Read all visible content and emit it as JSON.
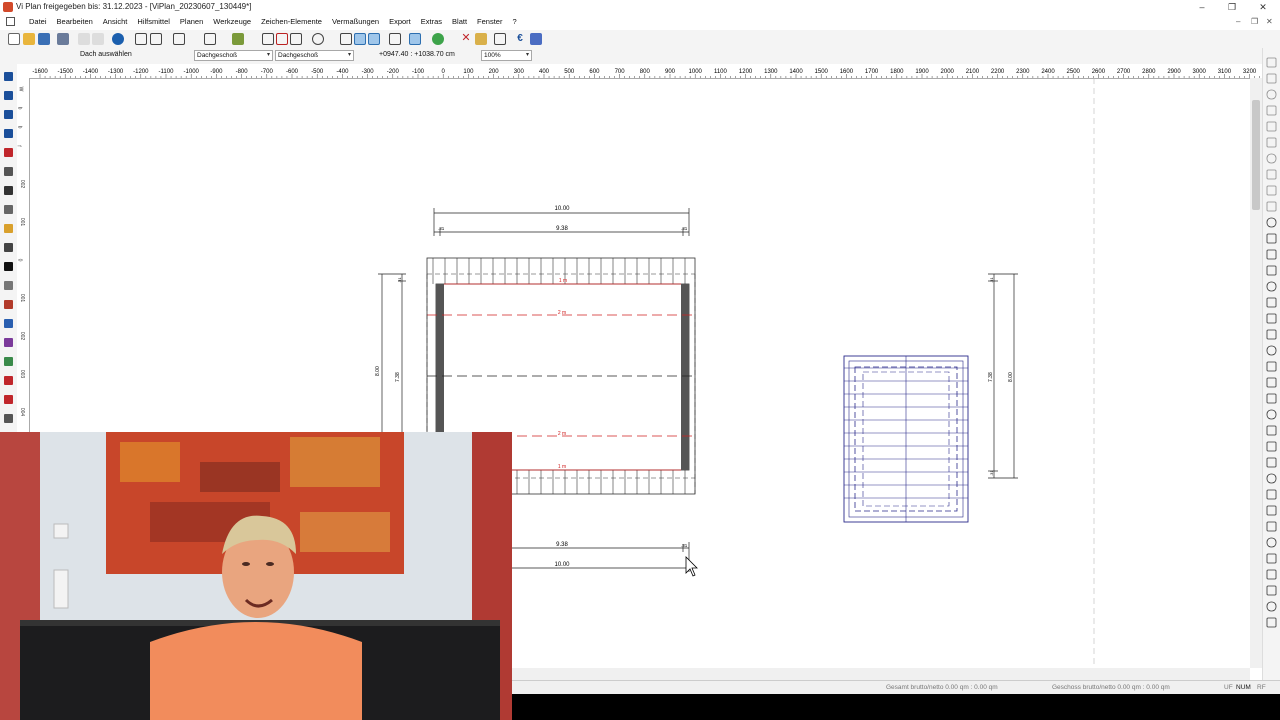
{
  "window": {
    "title": "Vi Plan freigegeben bis: 31.12.2023 - [ViPlan_20230607_130449*]",
    "controls": {
      "minimize": "–",
      "maximize": "❐",
      "close": "✕"
    }
  },
  "menu": {
    "items": [
      "Datei",
      "Bearbeiten",
      "Ansicht",
      "Hilfsmittel",
      "Planen",
      "Werkzeuge",
      "Zeichen-Elemente",
      "Vermaßungen",
      "Export",
      "Extras",
      "Blatt",
      "Fenster",
      "?"
    ],
    "mdi_controls": {
      "minimize": "–",
      "restore": "❐",
      "close": "✕"
    }
  },
  "options": {
    "label": "Dach auswählen",
    "combo1": "Dachgeschoß",
    "combo2": "Dachgeschoß",
    "coordinates": "+0947.40 : +1038.70 cm",
    "zoom": "100%"
  },
  "ruler": {
    "labels": [
      "-1600",
      "-1500",
      "-1400",
      "-1300",
      "-1200",
      "-1100",
      "-1000",
      "-900",
      "-800",
      "-700",
      "-600",
      "-500",
      "-400",
      "-300",
      "-200",
      "-100",
      "0",
      "100",
      "200",
      "300",
      "400",
      "500",
      "600",
      "700",
      "800",
      "900",
      "1000",
      "1100",
      "1200",
      "1300",
      "1400",
      "1500",
      "1600",
      "1700",
      "1800",
      "1900",
      "2000",
      "2100",
      "2200",
      "2300",
      "2400",
      "2500",
      "2600",
      "2700",
      "2800",
      "2900",
      "3000",
      "3100",
      "3200"
    ]
  },
  "vruler": {
    "labels": [
      "W",
      "b",
      "b",
      "f",
      "",
      "002",
      "",
      "001",
      "",
      "0",
      "",
      "001",
      "",
      "002",
      "",
      "003",
      "",
      "004"
    ]
  },
  "drawing": {
    "dims": {
      "top_total": "10.00",
      "top_inner": "9.38",
      "top_left_tick": ".31",
      "top_right_tick": ".31",
      "left_total": "8.00",
      "left_inner": "7.38",
      "left_top_tick": ".31",
      "bottom_inner": "9.38",
      "bottom_total": "10.00",
      "bottom_tick": ".31",
      "right_total": "8.00",
      "right_inner": "7.38",
      "right_top_tick": ".31",
      "right_bottom_tick": ".31"
    },
    "height_marks": {
      "m1_top": "1 m",
      "m2_top": "2 m",
      "m2_bottom": "2 m",
      "m1_bottom": "1 m"
    }
  },
  "status": {
    "gesamt": "Gesamt brutto/netto 0.00 qm : 0.00 qm",
    "geschoss": "Geschoss brutto/netto 0.00 qm : 0.00 qm",
    "uf": "UF",
    "num": "NUM",
    "rf": "RF"
  },
  "colors": {
    "dim_red": "#d02020",
    "plan_blue": "#2a2a8a",
    "wall_gray": "#555555"
  }
}
